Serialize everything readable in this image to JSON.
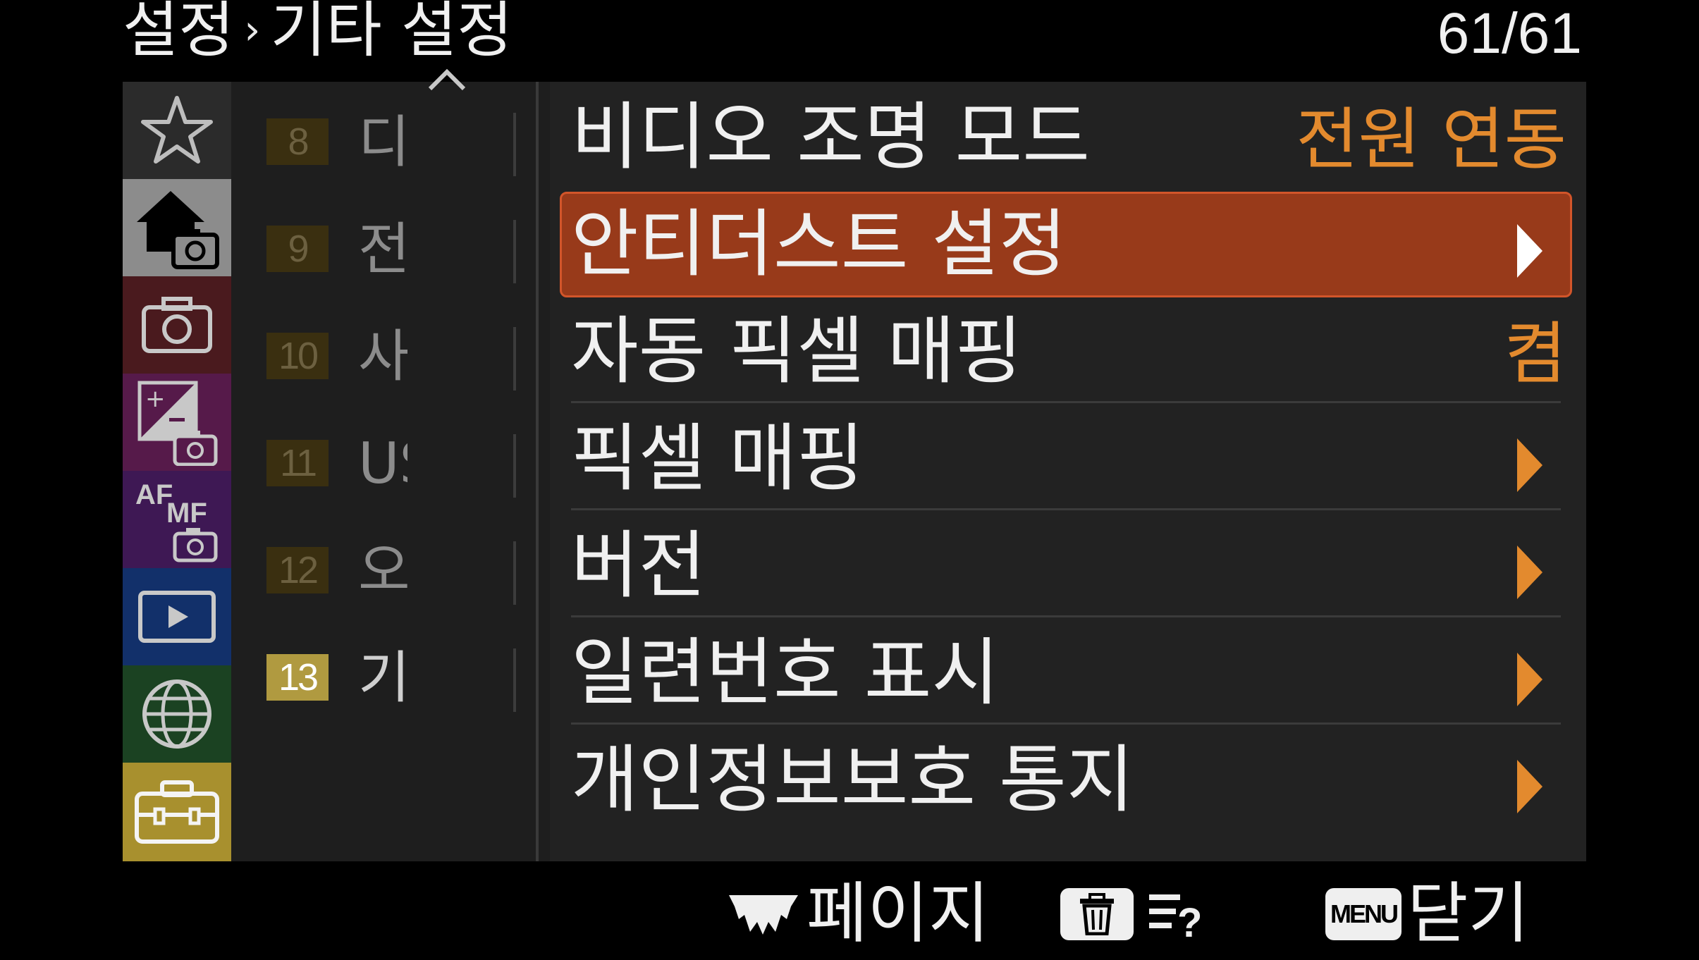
{
  "header": {
    "section": "설정",
    "separator": "›",
    "subsection": "기타 설정",
    "page_counter": "61/61"
  },
  "tabs": [
    {
      "name": "favorites",
      "icon": "star-icon",
      "color": "#2b2b2b"
    },
    {
      "name": "main",
      "icon": "home-camera-icon",
      "color": "#8c8c8c"
    },
    {
      "name": "shooting",
      "icon": "camera-icon",
      "color": "#4a1a1e"
    },
    {
      "name": "exposure-color",
      "icon": "exposure-camera-icon",
      "color": "#561a4a"
    },
    {
      "name": "focus",
      "icon": "af-mf-camera-icon",
      "color": "#3e1854"
    },
    {
      "name": "playback",
      "icon": "play-icon",
      "color": "#12306a"
    },
    {
      "name": "network",
      "icon": "globe-icon",
      "color": "#1b4222"
    },
    {
      "name": "setup",
      "icon": "toolbox-icon",
      "color": "#a8902e"
    }
  ],
  "pages": [
    {
      "num": "8",
      "label": "디"
    },
    {
      "num": "9",
      "label": "전"
    },
    {
      "num": "10",
      "label": "사"
    },
    {
      "num": "11",
      "label": "US"
    },
    {
      "num": "12",
      "label": "오"
    },
    {
      "num": "13",
      "label": "기",
      "active": true
    }
  ],
  "items": [
    {
      "label": "비디오 조명 모드",
      "value": "전원 연동"
    },
    {
      "label": "안티더스트 설정",
      "arrow": true,
      "selected": true
    },
    {
      "label": "자동 픽셀 매핑",
      "value": "켬"
    },
    {
      "label": "픽셀 매핑",
      "arrow": true
    },
    {
      "label": "버전",
      "arrow": true
    },
    {
      "label": "일련번호 표시",
      "arrow": true
    },
    {
      "label": "개인정보보호 통지",
      "arrow": true
    }
  ],
  "footer": {
    "page_label": "페이지",
    "menu_key": "MENU",
    "close_label": "닫기"
  },
  "colors": {
    "accent": "#e38a2e",
    "selected": "#983a1a",
    "active_page": "#b09a40"
  }
}
